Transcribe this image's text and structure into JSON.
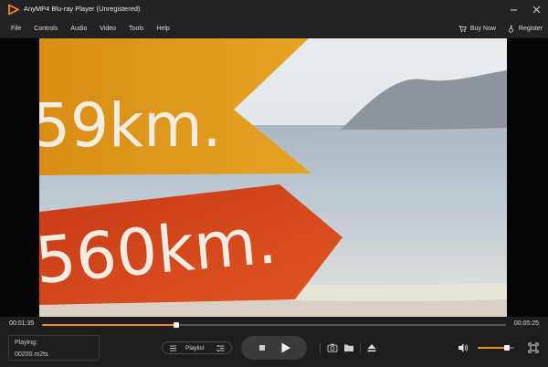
{
  "window": {
    "title": "AnyMP4 Blu-ray Player (Unregistered)"
  },
  "menu": {
    "items": [
      "File",
      "Controls",
      "Audio",
      "Video",
      "Tools",
      "Help"
    ],
    "buy_now": "Buy Now",
    "register": "Register"
  },
  "playback": {
    "current_time": "00:01:35",
    "total_time": "00:05:25",
    "progress_fraction": 0.29,
    "playing_label": "Playing:",
    "file_name": "00200.m2ts",
    "playlist_label": "Playlist",
    "volume_fraction": 0.8
  },
  "icons": {
    "logo": "play-triangle-logo-icon",
    "minimize": "minimize-icon",
    "close": "close-icon",
    "cart": "cart-icon",
    "register": "key-icon",
    "playlist_left": "list-icon",
    "playlist_right": "sort-list-icon",
    "stop": "stop-icon",
    "play": "play-icon",
    "snapshot": "camera-icon",
    "folder": "folder-icon",
    "eject": "eject-icon",
    "volume": "speaker-icon",
    "fullscreen": "fullscreen-icon"
  },
  "colors": {
    "accent": "#f08c1e",
    "background": "#1b1b1d",
    "sign_top": "#e39c1a",
    "sign_bottom": "#d5451b",
    "sign_text": "#f2ede4"
  },
  "video": {
    "sign_top_text": "59km.",
    "sign_bottom_text": "560km."
  }
}
